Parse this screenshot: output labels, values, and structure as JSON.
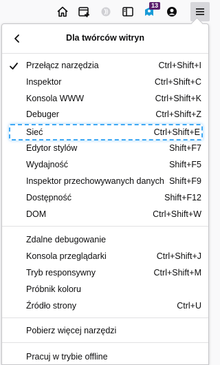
{
  "toolbar": {
    "icons": [
      "home-icon",
      "add-tab-icon",
      "extension-icon",
      "sidebar-icon",
      "notification-icon",
      "account-icon",
      "menu-icon"
    ],
    "badge_count": "13"
  },
  "panel": {
    "title": "Dla twórców witryn",
    "back_label": "Wstecz",
    "groups": [
      {
        "items": [
          {
            "label": "Przełącz narzędzia",
            "shortcut": "Ctrl+Shift+I",
            "checked": true
          },
          {
            "label": "Inspektor",
            "shortcut": "Ctrl+Shift+C"
          },
          {
            "label": "Konsola WWW",
            "shortcut": "Ctrl+Shift+K"
          },
          {
            "label": "Debuger",
            "shortcut": "Ctrl+Shift+Z"
          },
          {
            "label": "Sieć",
            "shortcut": "Ctrl+Shift+E",
            "highlighted": true
          },
          {
            "label": "Edytor stylów",
            "shortcut": "Shift+F7"
          },
          {
            "label": "Wydajność",
            "shortcut": "Shift+F5"
          },
          {
            "label": "Inspektor przechowywanych danych",
            "shortcut": "Shift+F9"
          },
          {
            "label": "Dostępność",
            "shortcut": "Shift+F12"
          },
          {
            "label": "DOM",
            "shortcut": "Ctrl+Shift+W"
          }
        ]
      },
      {
        "items": [
          {
            "label": "Zdalne debugowanie",
            "shortcut": ""
          },
          {
            "label": "Konsola przeglądarki",
            "shortcut": "Ctrl+Shift+J"
          },
          {
            "label": "Tryb responsywny",
            "shortcut": "Ctrl+Shift+M"
          },
          {
            "label": "Próbnik koloru",
            "shortcut": ""
          },
          {
            "label": "Źródło strony",
            "shortcut": "Ctrl+U"
          }
        ]
      },
      {
        "items": [
          {
            "label": "Pobierz więcej narzędzi",
            "shortcut": ""
          }
        ]
      },
      {
        "items": [
          {
            "label": "Pracuj w trybie offline",
            "shortcut": ""
          }
        ]
      }
    ]
  },
  "colors": {
    "highlight_border": "#3fa9f5",
    "badge_bg": "#5b1f6e"
  }
}
